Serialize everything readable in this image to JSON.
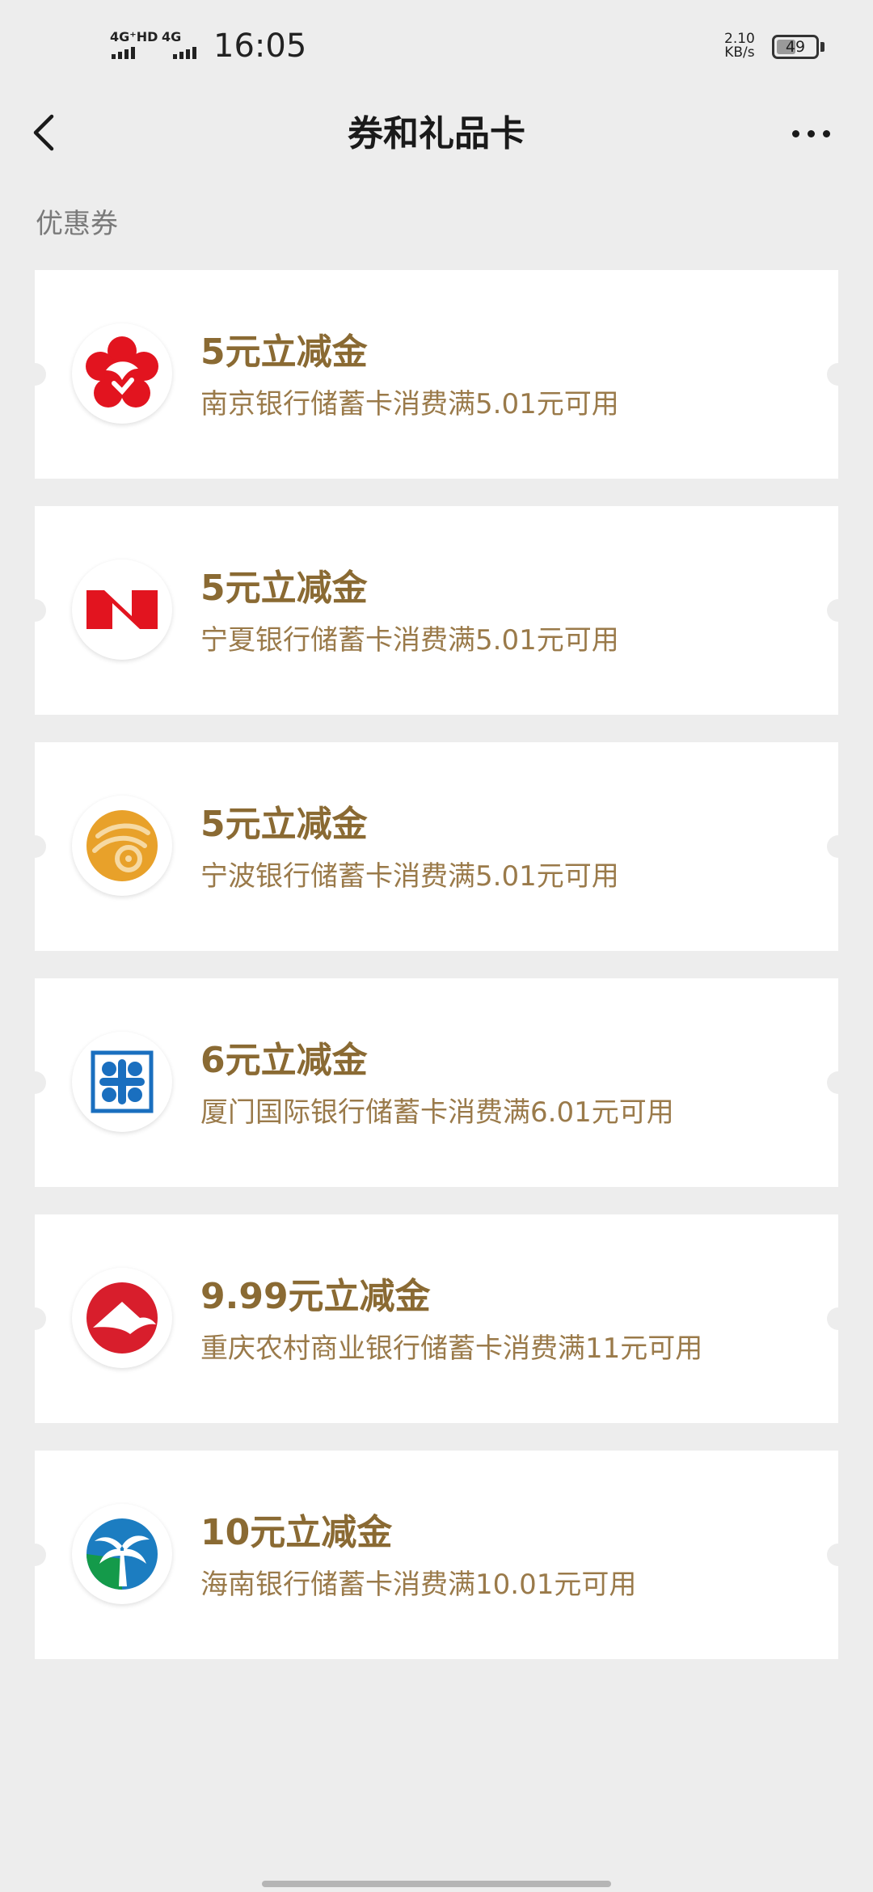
{
  "status_bar": {
    "signal1_label": "4G⁺HD",
    "signal2_label": "4G",
    "time": "16:05",
    "speed_value": "2.10",
    "speed_unit": "KB/s",
    "battery": "49",
    "battery_level": 0.49
  },
  "nav": {
    "back_icon": "back-chevron-icon",
    "title": "券和礼品卡",
    "more_icon": "more-icon"
  },
  "section": {
    "label": "优惠券"
  },
  "coupons": [
    {
      "title": "5元立减金",
      "desc": "南京银行储蓄卡消费满5.01元可用",
      "logo": "bank-of-nanjing-logo"
    },
    {
      "title": "5元立减金",
      "desc": "宁夏银行储蓄卡消费满5.01元可用",
      "logo": "bank-of-ningxia-logo"
    },
    {
      "title": "5元立减金",
      "desc": "宁波银行储蓄卡消费满5.01元可用",
      "logo": "bank-of-ningbo-logo"
    },
    {
      "title": "6元立减金",
      "desc": "厦门国际银行储蓄卡消费满6.01元可用",
      "logo": "xiamen-international-bank-logo"
    },
    {
      "title": "9.99元立减金",
      "desc": "重庆农村商业银行储蓄卡消费满11元可用",
      "logo": "chongqing-rural-commercial-bank-logo"
    },
    {
      "title": "10元立减金",
      "desc": "海南银行储蓄卡消费满10.01元可用",
      "logo": "hainan-bank-logo"
    }
  ],
  "colors": {
    "background": "#ededed",
    "card": "#ffffff",
    "coupon_title": "#8a6a33",
    "coupon_desc": "#9a7a4a"
  }
}
